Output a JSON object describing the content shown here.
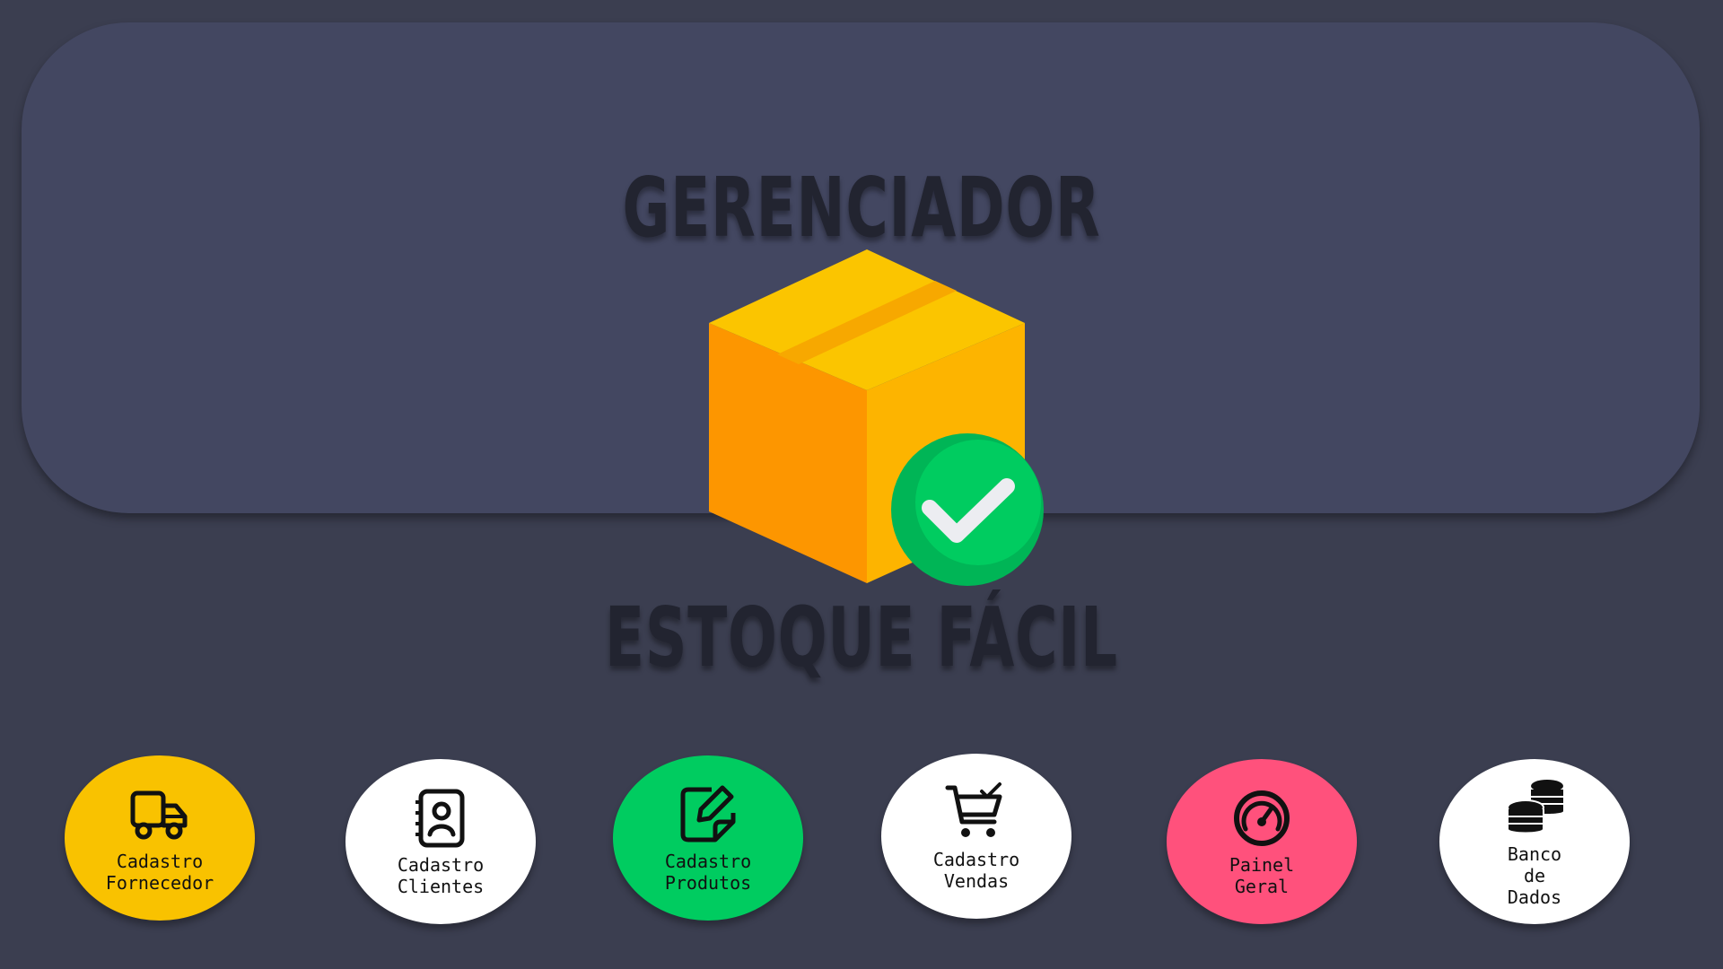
{
  "header": {
    "title_top": "GERENCIADOR",
    "title_bottom": "ESTOQUE FÁCIL",
    "logo_icon": "package-check-icon"
  },
  "colors": {
    "background": "#3b3e50",
    "panel": "#434761",
    "yellow": "#f9c200",
    "green": "#00cc60",
    "pink": "#ff517c",
    "white": "#ffffff"
  },
  "menu": {
    "items": [
      {
        "label": "Cadastro\nFornecedor",
        "icon": "truck-icon",
        "color": "#f9c200"
      },
      {
        "label": "Cadastro\nClientes",
        "icon": "contact-book-icon",
        "color": "#ffffff"
      },
      {
        "label": "Cadastro\nProdutos",
        "icon": "edit-note-icon",
        "color": "#00cc60"
      },
      {
        "label": "Cadastro\nVendas",
        "icon": "cart-check-icon",
        "color": "#ffffff"
      },
      {
        "label": "Painel\nGeral",
        "icon": "speedometer-icon",
        "color": "#ff517c"
      },
      {
        "label": "Banco\nde\nDados",
        "icon": "coins-stack-icon",
        "color": "#ffffff"
      }
    ]
  }
}
